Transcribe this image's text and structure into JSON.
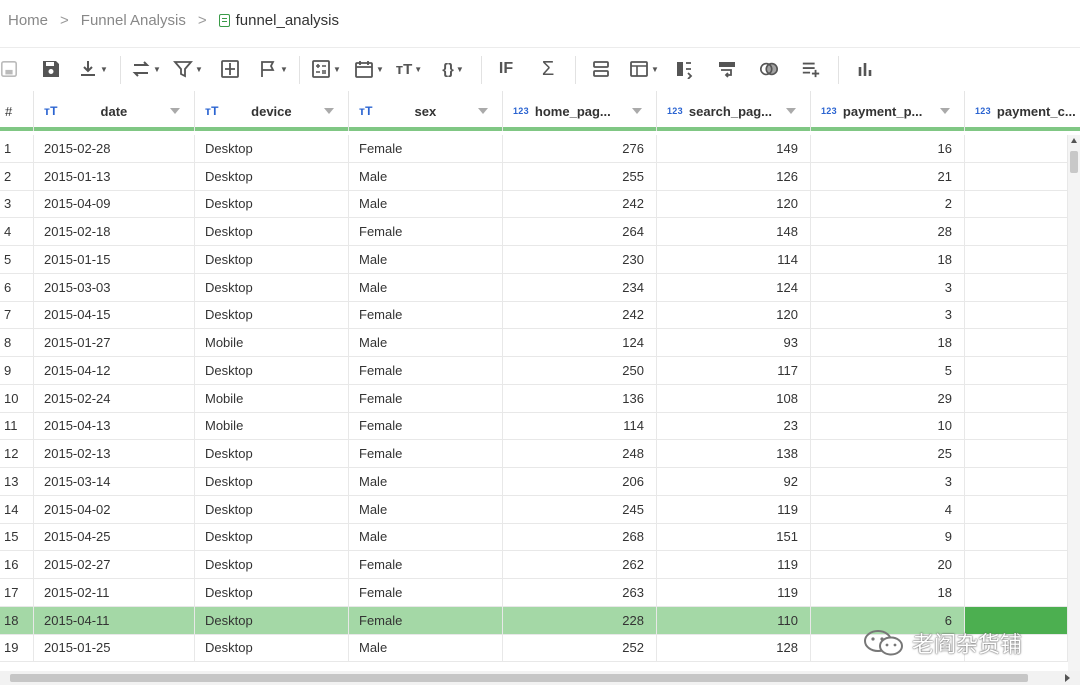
{
  "breadcrumb": {
    "home": "Home",
    "project": "Funnel Analysis",
    "file": "funnel_analysis",
    "separator": ">"
  },
  "toolbar": {
    "icons": [
      "save-disabled-icon",
      "save-icon",
      "download-icon",
      "transform-icon",
      "filter-icon",
      "fit-icon",
      "flag-icon",
      "calculate-icon",
      "calendar-icon",
      "text-format-icon",
      "json-icon",
      "if-icon",
      "sigma-icon",
      "merge-rows-icon",
      "table-icon",
      "split-icon",
      "wrap-icon",
      "join-icon",
      "add-row-icon",
      "chart-icon"
    ]
  },
  "grid": {
    "rownum_header": "#",
    "columns": [
      {
        "name": "date",
        "type": "text"
      },
      {
        "name": "device",
        "type": "text"
      },
      {
        "name": "sex",
        "type": "text"
      },
      {
        "name": "home_pag...",
        "type": "number"
      },
      {
        "name": "search_pag...",
        "type": "number"
      },
      {
        "name": "payment_p...",
        "type": "number"
      },
      {
        "name": "payment_c...",
        "type": "number"
      }
    ],
    "type_labels": {
      "text": "тT",
      "number": "123"
    },
    "rows": [
      {
        "n": "1",
        "date": "2015-02-28",
        "device": "Desktop",
        "sex": "Female",
        "home": "276",
        "search": "149",
        "payp": "16",
        "payc": ""
      },
      {
        "n": "2",
        "date": "2015-01-13",
        "device": "Desktop",
        "sex": "Male",
        "home": "255",
        "search": "126",
        "payp": "21",
        "payc": ""
      },
      {
        "n": "3",
        "date": "2015-04-09",
        "device": "Desktop",
        "sex": "Male",
        "home": "242",
        "search": "120",
        "payp": "2",
        "payc": ""
      },
      {
        "n": "4",
        "date": "2015-02-18",
        "device": "Desktop",
        "sex": "Female",
        "home": "264",
        "search": "148",
        "payp": "28",
        "payc": ""
      },
      {
        "n": "5",
        "date": "2015-01-15",
        "device": "Desktop",
        "sex": "Male",
        "home": "230",
        "search": "114",
        "payp": "18",
        "payc": ""
      },
      {
        "n": "6",
        "date": "2015-03-03",
        "device": "Desktop",
        "sex": "Male",
        "home": "234",
        "search": "124",
        "payp": "3",
        "payc": ""
      },
      {
        "n": "7",
        "date": "2015-04-15",
        "device": "Desktop",
        "sex": "Female",
        "home": "242",
        "search": "120",
        "payp": "3",
        "payc": ""
      },
      {
        "n": "8",
        "date": "2015-01-27",
        "device": "Mobile",
        "sex": "Male",
        "home": "124",
        "search": "93",
        "payp": "18",
        "payc": ""
      },
      {
        "n": "9",
        "date": "2015-04-12",
        "device": "Desktop",
        "sex": "Female",
        "home": "250",
        "search": "117",
        "payp": "5",
        "payc": ""
      },
      {
        "n": "10",
        "date": "2015-02-24",
        "device": "Mobile",
        "sex": "Female",
        "home": "136",
        "search": "108",
        "payp": "29",
        "payc": ""
      },
      {
        "n": "11",
        "date": "2015-04-13",
        "device": "Mobile",
        "sex": "Female",
        "home": "114",
        "search": "23",
        "payp": "10",
        "payc": ""
      },
      {
        "n": "12",
        "date": "2015-02-13",
        "device": "Desktop",
        "sex": "Female",
        "home": "248",
        "search": "138",
        "payp": "25",
        "payc": ""
      },
      {
        "n": "13",
        "date": "2015-03-14",
        "device": "Desktop",
        "sex": "Male",
        "home": "206",
        "search": "92",
        "payp": "3",
        "payc": ""
      },
      {
        "n": "14",
        "date": "2015-04-02",
        "device": "Desktop",
        "sex": "Male",
        "home": "245",
        "search": "119",
        "payp": "4",
        "payc": ""
      },
      {
        "n": "15",
        "date": "2015-04-25",
        "device": "Desktop",
        "sex": "Male",
        "home": "268",
        "search": "151",
        "payp": "9",
        "payc": ""
      },
      {
        "n": "16",
        "date": "2015-02-27",
        "device": "Desktop",
        "sex": "Female",
        "home": "262",
        "search": "119",
        "payp": "20",
        "payc": ""
      },
      {
        "n": "17",
        "date": "2015-02-11",
        "device": "Desktop",
        "sex": "Female",
        "home": "263",
        "search": "119",
        "payp": "18",
        "payc": ""
      },
      {
        "n": "18",
        "date": "2015-04-11",
        "device": "Desktop",
        "sex": "Female",
        "home": "228",
        "search": "110",
        "payp": "6",
        "payc": "",
        "selected": true
      },
      {
        "n": "19",
        "date": "2015-01-25",
        "device": "Desktop",
        "sex": "Male",
        "home": "252",
        "search": "128",
        "payp": "",
        "payc": ""
      }
    ]
  },
  "watermark": "老阎杂货铺",
  "colors": {
    "accent": "#80c784",
    "selected_row": "#a4d8a6",
    "selected_cell": "#4caf50",
    "type_icon": "#2b64d1"
  }
}
